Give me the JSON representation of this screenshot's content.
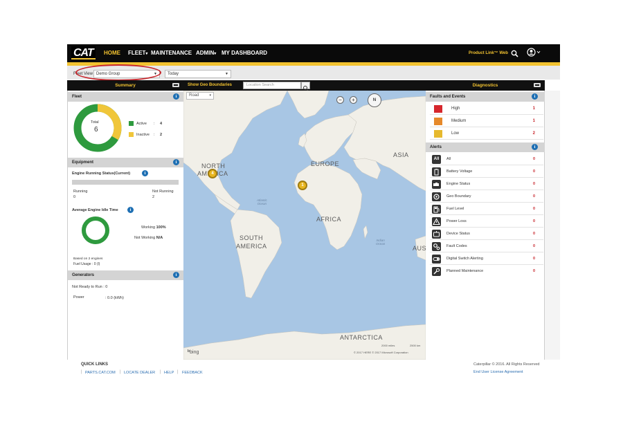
{
  "nav": {
    "logo": "CAT",
    "items": [
      {
        "label": "HOME",
        "active": true
      },
      {
        "label": "FLEET",
        "caret": "▾"
      },
      {
        "label": "MAINTENANCE"
      },
      {
        "label": "ADMIN",
        "caret": "▾"
      },
      {
        "label": "MY DASHBOARD"
      }
    ],
    "product_link": "Product Link™ Web",
    "accent_color": "#f2c230"
  },
  "filter": {
    "fleet_view_label": "Fleet View",
    "group_value": "Demo Group",
    "period_value": "Today"
  },
  "summary": {
    "header": "Summary",
    "fleet": {
      "title": "Fleet",
      "total_label": "Total",
      "total": "6",
      "active_label": "Active",
      "active_sep": ":",
      "active": "4",
      "inactive_label": "Inactive",
      "inactive_sep": ":",
      "inactive": "2",
      "active_color": "#2e9a3e",
      "inactive_color": "#f0c63a"
    },
    "equipment": {
      "title": "Equipment",
      "engine_status_label": "Engine Running Status(Current)",
      "running_label": "Running",
      "running": "0",
      "not_running_label": "Not Running",
      "not_running": "2",
      "running_fraction": 0,
      "idle_label": "Average Engine Idle Time",
      "working_label": "Working",
      "working": "100%",
      "not_working_label": "Not Working",
      "not_working": "N/A",
      "working_fraction": 1.0,
      "based_on": "Based on 2 engines",
      "fuel_usage": "Fuel Usage :  0  (l)"
    },
    "generators": {
      "title": "Generators",
      "not_ready": "Not Ready to Run  :   0",
      "power_label": "Power",
      "power_value": ":  0.0  (kWh)"
    }
  },
  "map": {
    "show_geo_label": "Show Geo Boundaries",
    "location_placeholder": "Location Search",
    "road_label": "Road",
    "zoom_out": "−",
    "zoom_in": "+",
    "compass_label": "N",
    "labels": {
      "north_america_1": "NORTH",
      "north_america_2": "AMERICA",
      "europe": "EUROPE",
      "asia": "ASIA",
      "africa": "AFRICA",
      "south_america_1": "SOUTH",
      "south_america_2": "AMERICA",
      "antarctica": "ANTARCTICA",
      "aus": "AUS",
      "atlantic_1": "Atlantic",
      "atlantic_2": "Ocean",
      "indian_1": "Indian",
      "indian_2": "Ocean"
    },
    "markers": [
      {
        "count": "4"
      },
      {
        "count": "1"
      }
    ],
    "bing": "bing",
    "scale_miles": "2000 miles",
    "scale_km": "2500 km",
    "copyright": "© 2017 HERE   © 2017 Microsoft Corporation"
  },
  "diagnostics": {
    "header": "Diagnostics",
    "faults_title": "Faults and Events",
    "faults": [
      {
        "label": "High",
        "count": "1",
        "color": "#d6262c"
      },
      {
        "label": "Medium",
        "count": "1",
        "color": "#e6892a"
      },
      {
        "label": "Low",
        "count": "2",
        "color": "#e6b92e"
      }
    ],
    "alerts_title": "Alerts",
    "alerts": [
      {
        "label": "All",
        "count": "0",
        "icon": "all-icon"
      },
      {
        "label": "Battery Voltage",
        "count": "0",
        "icon": "battery-icon"
      },
      {
        "label": "Engine Status",
        "count": "0",
        "icon": "engine-icon"
      },
      {
        "label": "Geo Boundary",
        "count": "0",
        "icon": "geo-boundary-icon"
      },
      {
        "label": "Fuel Level",
        "count": "0",
        "icon": "fuel-icon"
      },
      {
        "label": "Power Loss",
        "count": "0",
        "icon": "warning-icon"
      },
      {
        "label": "Device Status",
        "count": "0",
        "icon": "device-icon"
      },
      {
        "label": "Fault Codes",
        "count": "0",
        "icon": "gears-icon"
      },
      {
        "label": "Digital Switch Alerting",
        "count": "0",
        "icon": "switch-icon"
      },
      {
        "label": "Planned Maintenance",
        "count": "0",
        "icon": "wrench-icon"
      }
    ]
  },
  "footer": {
    "quick_links_title": "QUICK LINKS",
    "links": [
      "PARTS.CAT.COM",
      "LOCATE DEALER",
      "HELP",
      "FEEDBACK"
    ],
    "copyright": "Caterpillar © 2016. All Rights Reserved",
    "eula": "End User License Agreement"
  }
}
